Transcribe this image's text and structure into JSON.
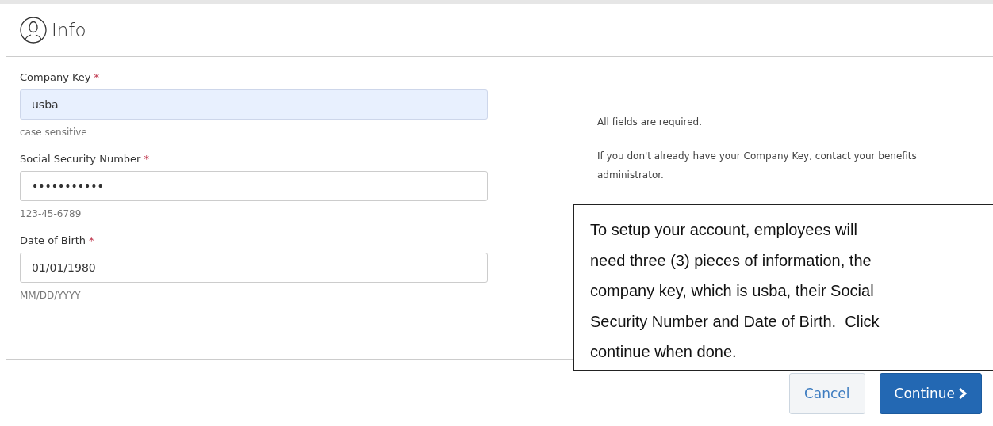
{
  "header": {
    "title": "Info"
  },
  "fields": [
    {
      "label": "Company Key",
      "required_mark": "*",
      "value": "usba",
      "highlighted": true,
      "hint": "case sensitive"
    },
    {
      "label": "Social Security Number",
      "required_mark": "*",
      "value": "•••••••••••",
      "highlighted": false,
      "hint": "123-45-6789"
    },
    {
      "label": "Date of Birth",
      "required_mark": "*",
      "value": "01/01/1980",
      "highlighted": false,
      "hint": "MM/DD/YYYY"
    }
  ],
  "notes": [
    "All fields are required.",
    "If you don't already have your Company Key, contact your benefits administrator."
  ],
  "callout": [
    "To setup your account, employees will",
    "need three (3) pieces of information, the",
    "company key, which is usba, their Social",
    "Security Number and Date of Birth.  Click",
    "continue when done."
  ],
  "buttons": [
    {
      "label": "Cancel",
      "kind": "secondary"
    },
    {
      "label": "Continue",
      "kind": "primary"
    }
  ]
}
